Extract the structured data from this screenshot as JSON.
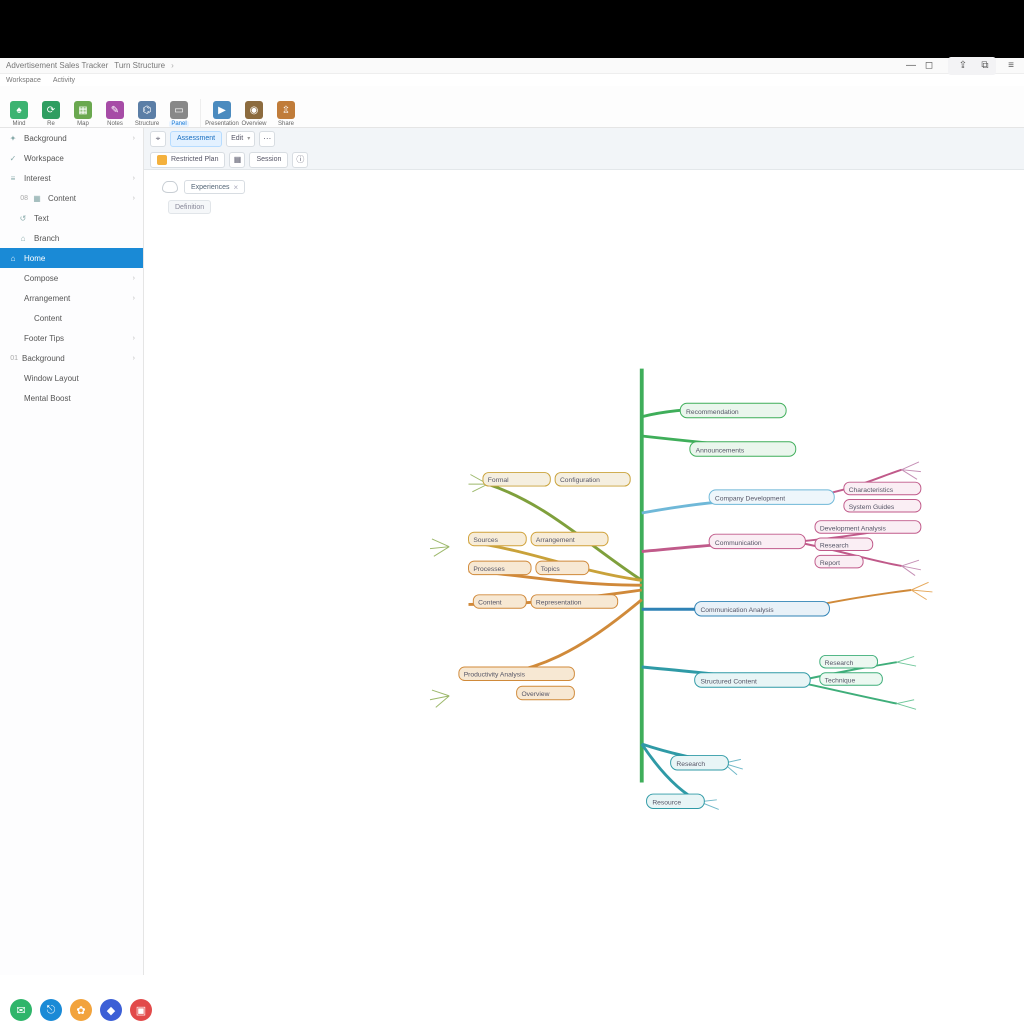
{
  "titlebar": {
    "crumb1": "Advertisement Sales Tracker",
    "crumb2": "Turn Structure",
    "min_tip": "Minimize",
    "max_tip": "Maximize"
  },
  "menubar": {
    "items": [
      "Workspace",
      "Activity"
    ]
  },
  "ribbon": {
    "items": [
      {
        "label": "Mind",
        "color": "#3cb371"
      },
      {
        "label": "Re",
        "color": "#2f9e61"
      },
      {
        "label": "Map",
        "color": "#6aa84f"
      },
      {
        "label": "Notes",
        "color": "#a64ca6"
      },
      {
        "label": "Structure",
        "color": "#5b7ea6"
      },
      {
        "label": "Panel",
        "color": "#888",
        "active": true
      },
      {
        "label": "Presentation",
        "color": "#4b8bbf"
      },
      {
        "label": "Overview",
        "color": "#8c6b3e"
      },
      {
        "label": "Share",
        "color": "#c07c3a"
      }
    ]
  },
  "sidebar": {
    "items": [
      {
        "label": "Background",
        "icon": "✦",
        "arrow": true
      },
      {
        "label": "Workspace",
        "icon": "✓",
        "arrow": false
      },
      {
        "label": "Interest",
        "icon": "≡",
        "arrow": true
      },
      {
        "label": "Content",
        "icon": "▦",
        "arrow": true,
        "indent": true,
        "num": "08"
      },
      {
        "label": "Text",
        "icon": "↺",
        "arrow": false,
        "indent": true
      },
      {
        "label": "Branch",
        "icon": "⌂",
        "arrow": false,
        "indent": true
      },
      {
        "label": "Home",
        "icon": "⌂",
        "arrow": false,
        "active": true
      },
      {
        "label": "Compose",
        "icon": "",
        "arrow": true
      },
      {
        "label": "Arrangement",
        "icon": "",
        "arrow": true
      },
      {
        "label": "Content",
        "icon": "",
        "arrow": false,
        "indent": true
      },
      {
        "label": "Footer Tips",
        "icon": "",
        "arrow": true
      },
      {
        "label": "Background",
        "icon": "",
        "arrow": true,
        "num": "01"
      },
      {
        "label": "Window Layout",
        "icon": "",
        "arrow": false
      },
      {
        "label": "Mental Boost",
        "icon": "",
        "arrow": false
      }
    ]
  },
  "secondary": {
    "row1": {
      "btn1": "Assessment",
      "dd1": "Edit",
      "dd1_tri": "▾"
    },
    "row2": {
      "btn1": "Restricted Plan",
      "btn2": "Session"
    }
  },
  "tags": {
    "main": "Experiences",
    "sub": "Definition"
  },
  "mindmap": {
    "left": [
      {
        "label": "Formal",
        "sub": "Configuration",
        "color": "#7fa03c"
      },
      {
        "label": "Sources",
        "sub": "Arrangement",
        "color": "#c9a23a"
      },
      {
        "label": "Processes",
        "sub": "Topics",
        "color": "#d0893a"
      },
      {
        "label": "Content",
        "sub": "Representation",
        "color": "#d0893a"
      },
      {
        "label": "Productivity Analysis",
        "sub": "Overview",
        "color": "#d08a3a"
      }
    ],
    "right": [
      {
        "label": "Recommendation",
        "color": "#3fae5a"
      },
      {
        "label": "Announcements",
        "color": "#3fae5a"
      },
      {
        "label": "Company Development",
        "color": "#6fb8d8",
        "subs": [
          "Characteristics",
          "System Guides"
        ]
      },
      {
        "label": "Communication",
        "color": "#c05a8a",
        "subs": [
          "Development Analysis",
          "Research",
          "Report"
        ]
      },
      {
        "label": "Communication Analysis",
        "color": "#2f82b5"
      },
      {
        "label": "Structured Content",
        "color": "#2f9aa6",
        "subs": [
          "Research",
          "Technique"
        ]
      },
      {
        "label": "Research",
        "color": "#2f9aa6"
      },
      {
        "label": "Resource",
        "color": "#2f9aa6"
      }
    ]
  },
  "dock": {
    "items": [
      {
        "color": "#2fb56a",
        "glyph": "✉"
      },
      {
        "color": "#1a8ad6",
        "glyph": "⎋"
      },
      {
        "color": "#f2a33c",
        "glyph": "✿"
      },
      {
        "color": "#3c5fd6",
        "glyph": "◆"
      },
      {
        "color": "#e24a4a",
        "glyph": "▣"
      }
    ]
  }
}
